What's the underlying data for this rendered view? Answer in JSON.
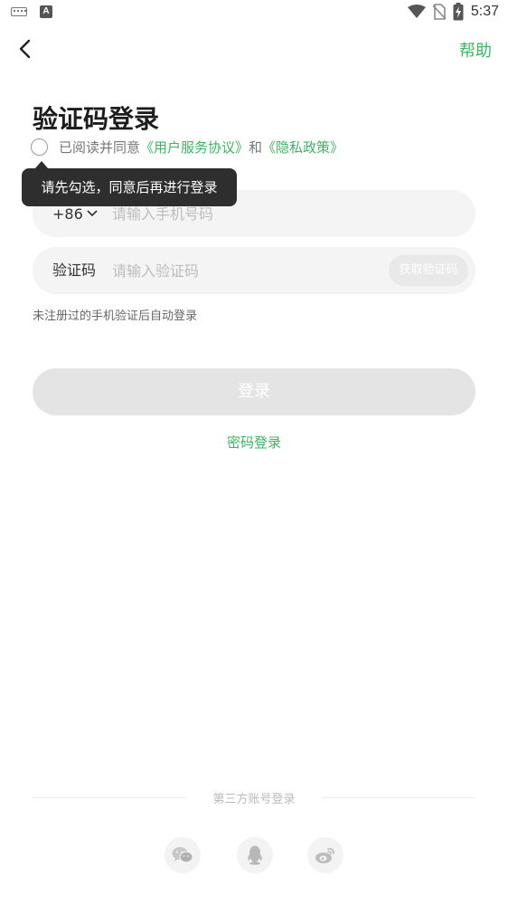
{
  "status_bar": {
    "left_icons": [
      "keyboard-icon",
      "a-icon"
    ],
    "a_glyph": "A",
    "right_icons": [
      "wifi-icon",
      "no-sim-icon",
      "battery-charging-icon"
    ],
    "time": "5:37"
  },
  "header": {
    "back_icon": "chevron-left-icon",
    "help_label": "帮助"
  },
  "title": "验证码登录",
  "agreement": {
    "prefix": "已阅读并同意",
    "user_agreement": "《用户服务协议》",
    "and": "和",
    "privacy_policy": "《隐私政策》",
    "checked": false
  },
  "tooltip": {
    "text": "请先勾选，同意后再进行登录"
  },
  "phone_field": {
    "country_code": "+86",
    "placeholder": "请输入手机号码",
    "value": ""
  },
  "code_field": {
    "label": "验证码",
    "placeholder": "请输入验证码",
    "value": "",
    "get_code_label": "获取验证码"
  },
  "hint": "未注册过的手机验证后自动登录",
  "login_button": "登录",
  "password_login": "密码登录",
  "third_party": {
    "label": "第三方账号登录",
    "icons": [
      "wechat-icon",
      "qq-icon",
      "weibo-icon"
    ]
  },
  "colors": {
    "accent": "#3cb563",
    "tooltip_bg": "#2e2e2e",
    "field_bg": "#f4f4f4",
    "button_disabled": "#e4e4e4"
  }
}
